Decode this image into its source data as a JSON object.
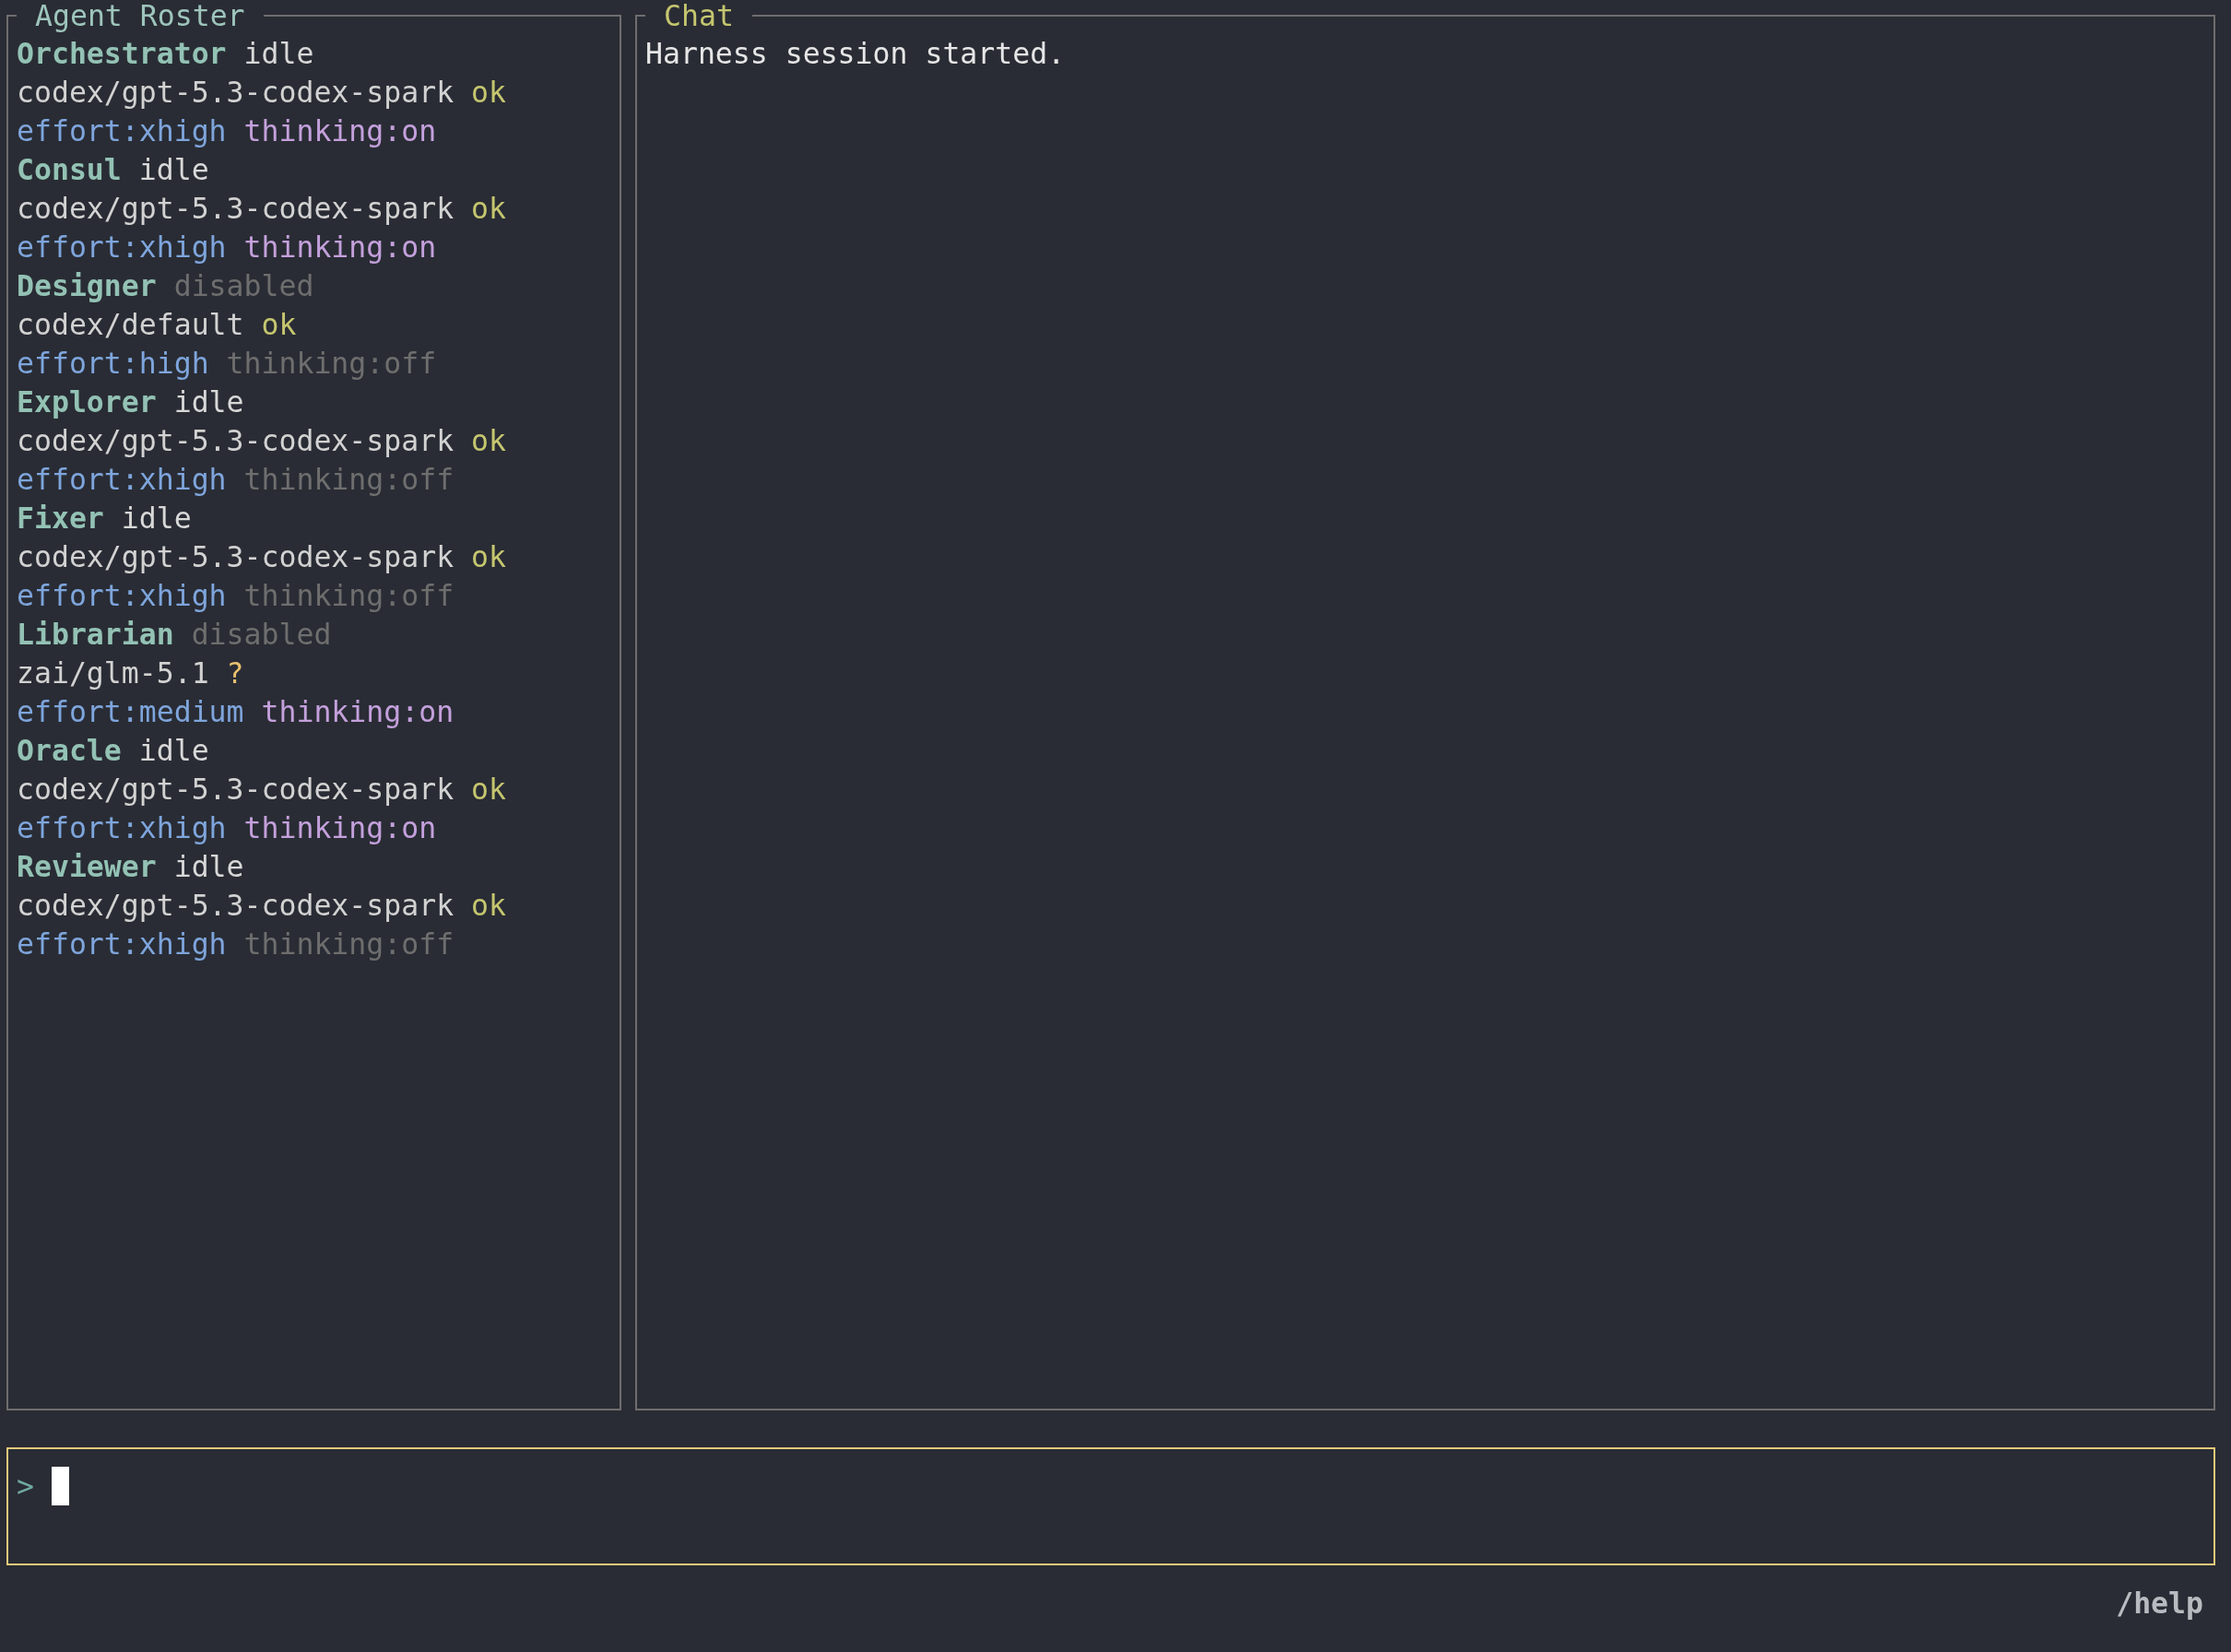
{
  "roster": {
    "title": "Agent Roster",
    "agents": [
      {
        "name": "Orchestrator",
        "status": "idle",
        "disabled": false,
        "model": "codex/gpt-5.3-codex-spark",
        "model_check": {
          "text": "ok",
          "kind": "ok"
        },
        "effort": "effort:xhigh",
        "thinking": "thinking:on",
        "thinking_on": true
      },
      {
        "name": "Consul",
        "status": "idle",
        "disabled": false,
        "model": "codex/gpt-5.3-codex-spark",
        "model_check": {
          "text": "ok",
          "kind": "ok"
        },
        "effort": "effort:xhigh",
        "thinking": "thinking:on",
        "thinking_on": true
      },
      {
        "name": "Designer",
        "status": "disabled",
        "disabled": true,
        "model": "codex/default",
        "model_check": {
          "text": "ok",
          "kind": "ok"
        },
        "effort": "effort:high",
        "thinking": "thinking:off",
        "thinking_on": false
      },
      {
        "name": "Explorer",
        "status": "idle",
        "disabled": false,
        "model": "codex/gpt-5.3-codex-spark",
        "model_check": {
          "text": "ok",
          "kind": "ok"
        },
        "effort": "effort:xhigh",
        "thinking": "thinking:off",
        "thinking_on": false
      },
      {
        "name": "Fixer",
        "status": "idle",
        "disabled": false,
        "model": "codex/gpt-5.3-codex-spark",
        "model_check": {
          "text": "ok",
          "kind": "ok"
        },
        "effort": "effort:xhigh",
        "thinking": "thinking:off",
        "thinking_on": false
      },
      {
        "name": "Librarian",
        "status": "disabled",
        "disabled": true,
        "model": "zai/glm-5.1",
        "model_check": {
          "text": "?",
          "kind": "unknown"
        },
        "effort": "effort:medium",
        "thinking": "thinking:on",
        "thinking_on": true
      },
      {
        "name": "Oracle",
        "status": "idle",
        "disabled": false,
        "model": "codex/gpt-5.3-codex-spark",
        "model_check": {
          "text": "ok",
          "kind": "ok"
        },
        "effort": "effort:xhigh",
        "thinking": "thinking:on",
        "thinking_on": true
      },
      {
        "name": "Reviewer",
        "status": "idle",
        "disabled": false,
        "model": "codex/gpt-5.3-codex-spark",
        "model_check": {
          "text": "ok",
          "kind": "ok"
        },
        "effort": "effort:xhigh",
        "thinking": "thinking:off",
        "thinking_on": false
      }
    ]
  },
  "chat": {
    "title": "Chat",
    "messages": [
      "Harness session started."
    ]
  },
  "composer": {
    "prompt": ">",
    "focused": true
  },
  "hint": "/help"
}
